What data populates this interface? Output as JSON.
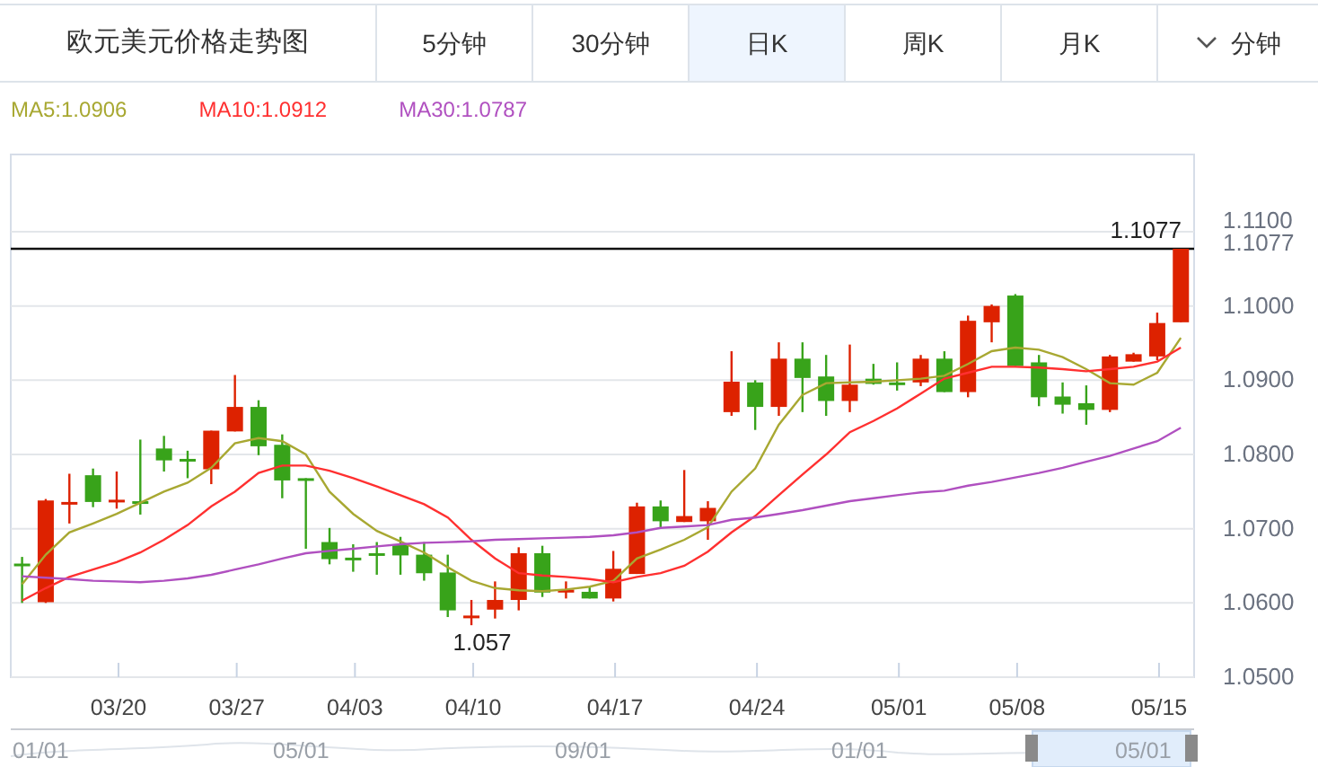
{
  "header": {
    "title": "欧元美元价格走势图"
  },
  "tabs": [
    {
      "label": "5分钟",
      "selected": false
    },
    {
      "label": "30分钟",
      "selected": false
    },
    {
      "label": "日K",
      "selected": true
    },
    {
      "label": "周K",
      "selected": false
    },
    {
      "label": "月K",
      "selected": false
    }
  ],
  "interval_dropdown": {
    "label": "分钟"
  },
  "chart": {
    "chart_data": {
      "type": "candlestick",
      "categories": [
        null,
        null,
        null,
        null,
        "03/20",
        null,
        null,
        null,
        null,
        "03/27",
        null,
        null,
        null,
        null,
        "04/03",
        null,
        null,
        null,
        null,
        "04/10",
        null,
        null,
        null,
        null,
        null,
        "04/17",
        null,
        null,
        null,
        null,
        null,
        "04/24",
        null,
        null,
        null,
        null,
        null,
        "05/01",
        null,
        null,
        null,
        null,
        "05/08",
        null,
        null,
        null,
        null,
        null,
        "05/15",
        null
      ],
      "ohlc": [
        [
          1.0653,
          1.0662,
          1.06,
          1.065
        ],
        [
          1.0601,
          1.074,
          1.06,
          1.0738
        ],
        [
          1.0734,
          1.0774,
          1.0707,
          1.0736
        ],
        [
          1.0772,
          1.0781,
          1.0729,
          1.0736
        ],
        [
          1.0737,
          1.0777,
          1.0727,
          1.0739
        ],
        [
          1.0737,
          1.082,
          1.0719,
          1.0736
        ],
        [
          1.0808,
          1.0825,
          1.0777,
          1.0792
        ],
        [
          1.0794,
          1.0805,
          1.0768,
          1.0793
        ],
        [
          1.078,
          1.0832,
          1.076,
          1.0832
        ],
        [
          1.0831,
          1.0907,
          1.0831,
          1.0864
        ],
        [
          1.0864,
          1.0873,
          1.0799,
          1.0811
        ],
        [
          1.0813,
          1.0827,
          1.0741,
          1.0765
        ],
        [
          1.0768,
          1.0768,
          1.0673,
          1.0767
        ],
        [
          1.0682,
          1.0701,
          1.0652,
          1.0659
        ],
        [
          1.0661,
          1.0679,
          1.0642,
          1.066
        ],
        [
          1.0667,
          1.0682,
          1.0638,
          1.0666
        ],
        [
          1.0679,
          1.0689,
          1.0638,
          1.0664
        ],
        [
          1.0665,
          1.0682,
          1.063,
          1.064
        ],
        [
          1.0641,
          1.0665,
          1.0581,
          1.059
        ],
        [
          1.0582,
          1.0604,
          1.057,
          1.0583
        ],
        [
          1.0591,
          1.0629,
          1.0579,
          1.0604
        ],
        [
          1.0604,
          1.0675,
          1.059,
          1.0667
        ],
        [
          1.0667,
          1.0677,
          1.0608,
          1.0614
        ],
        [
          1.0614,
          1.0629,
          1.0606,
          1.0618
        ],
        [
          1.0615,
          1.0622,
          1.0606,
          1.0606
        ],
        [
          1.0606,
          1.067,
          1.0602,
          1.0646
        ],
        [
          1.0639,
          1.0735,
          1.0639,
          1.073
        ],
        [
          1.073,
          1.0738,
          1.0701,
          1.071
        ],
        [
          1.0709,
          1.0779,
          1.0709,
          1.0717
        ],
        [
          1.071,
          1.0737,
          1.0685,
          1.0728
        ],
        [
          1.0857,
          1.0939,
          1.0852,
          1.0898
        ],
        [
          1.0897,
          1.09,
          1.0833,
          1.0864
        ],
        [
          1.0864,
          1.0951,
          1.0852,
          1.0929
        ],
        [
          1.0929,
          1.0951,
          1.0857,
          1.0903
        ],
        [
          1.0905,
          1.0934,
          1.0852,
          1.0872
        ],
        [
          1.0872,
          1.0948,
          1.0857,
          1.0894
        ],
        [
          1.0902,
          1.0922,
          1.0894,
          1.0895
        ],
        [
          1.0897,
          1.0924,
          1.0886,
          1.0896
        ],
        [
          1.0897,
          1.0934,
          1.0892,
          1.0929
        ],
        [
          1.0929,
          1.0939,
          1.0884,
          1.0884
        ],
        [
          1.0884,
          1.0987,
          1.0877,
          1.098
        ],
        [
          1.0978,
          1.1002,
          1.0951,
          1.1
        ],
        [
          1.1014,
          1.1016,
          1.0919,
          1.0919
        ],
        [
          1.0924,
          1.0934,
          1.0865,
          1.0877
        ],
        [
          1.0878,
          1.0897,
          1.0855,
          1.0867
        ],
        [
          1.0869,
          1.0893,
          1.084,
          1.086
        ],
        [
          1.086,
          1.0934,
          1.0857,
          1.0932
        ],
        [
          1.0925,
          1.0937,
          1.0925,
          1.0935
        ],
        [
          1.0932,
          1.0991,
          1.0927,
          1.0977
        ],
        [
          1.0978,
          1.1077,
          1.0978,
          1.1077
        ]
      ],
      "series": [
        {
          "name": "MA5:1.0906",
          "type": "line",
          "color": "#a8a832",
          "values": [
            1.0625,
            1.0665,
            1.0695,
            1.0707,
            1.072,
            1.0735,
            1.075,
            1.0762,
            1.0782,
            1.0815,
            1.0822,
            1.0818,
            1.08,
            1.075,
            1.072,
            1.0697,
            1.0683,
            1.0668,
            1.0648,
            1.063,
            1.062,
            1.0617,
            1.0616,
            1.0618,
            1.0622,
            1.063,
            1.066,
            1.0672,
            1.0685,
            1.0702,
            1.075,
            1.0781,
            1.084,
            1.088,
            1.0896,
            1.0897,
            1.0898,
            1.09,
            1.0902,
            1.0906,
            1.0922,
            1.0939,
            1.0944,
            1.0941,
            1.0931,
            1.0915,
            1.0896,
            1.0894,
            1.091,
            1.0957
          ]
        },
        {
          "name": "MA10:1.0912",
          "type": "line",
          "color": "#ff3030",
          "values": [
            1.0603,
            1.062,
            1.0635,
            1.0645,
            1.0655,
            1.0668,
            1.0685,
            1.0705,
            1.073,
            1.075,
            1.0775,
            1.0785,
            1.0785,
            1.0778,
            1.0768,
            1.0757,
            1.0745,
            1.0733,
            1.0715,
            1.0685,
            1.066,
            1.064,
            1.0637,
            1.0635,
            1.0632,
            1.0628,
            1.0635,
            1.064,
            1.065,
            1.0669,
            1.0695,
            1.0717,
            1.0745,
            1.0773,
            1.08,
            1.083,
            1.0845,
            1.0862,
            1.0882,
            1.0902,
            1.091,
            1.0918,
            1.0918,
            1.0917,
            1.0915,
            1.0912,
            1.0915,
            1.0918,
            1.0925,
            1.0944
          ]
        },
        {
          "name": "MA30:1.0787",
          "type": "line",
          "color": "#b050c0",
          "values": [
            1.0636,
            1.0634,
            1.0632,
            1.063,
            1.0629,
            1.0628,
            1.063,
            1.0633,
            1.0638,
            1.0645,
            1.0652,
            1.066,
            1.0667,
            1.067,
            1.0673,
            1.0676,
            1.0679,
            1.0681,
            1.0682,
            1.0683,
            1.0685,
            1.0686,
            1.0687,
            1.0688,
            1.0689,
            1.0691,
            1.0695,
            1.0701,
            1.0703,
            1.0705,
            1.0712,
            1.0715,
            1.072,
            1.0725,
            1.0731,
            1.0737,
            1.0741,
            1.0745,
            1.0749,
            1.0751,
            1.0758,
            1.0763,
            1.0769,
            1.0775,
            1.0782,
            1.079,
            1.0798,
            1.0808,
            1.0818,
            1.0836
          ]
        }
      ],
      "ylim": [
        1.05,
        1.1204
      ],
      "yticks": [
        {
          "value": 1.05,
          "label": "1.0500"
        },
        {
          "value": 1.06,
          "label": "1.0600"
        },
        {
          "value": 1.07,
          "label": "1.0700"
        },
        {
          "value": 1.08,
          "label": "1.0800"
        },
        {
          "value": 1.09,
          "label": "1.0900"
        },
        {
          "value": 1.1,
          "label": "1.1000"
        },
        {
          "value": 1.11,
          "label": "1.1100"
        }
      ],
      "grid": true,
      "ref_lines": [
        {
          "axis": "y",
          "value": 1.1077,
          "label": "1.1077"
        }
      ],
      "annotations": [
        {
          "text": "1.057",
          "x": "04/10",
          "y": 1.057
        }
      ]
    },
    "current_price_tag": "1.1077"
  },
  "navigator": {
    "labels": [
      "01/01",
      "05/01",
      "09/01",
      "01/01",
      "05/01"
    ]
  }
}
